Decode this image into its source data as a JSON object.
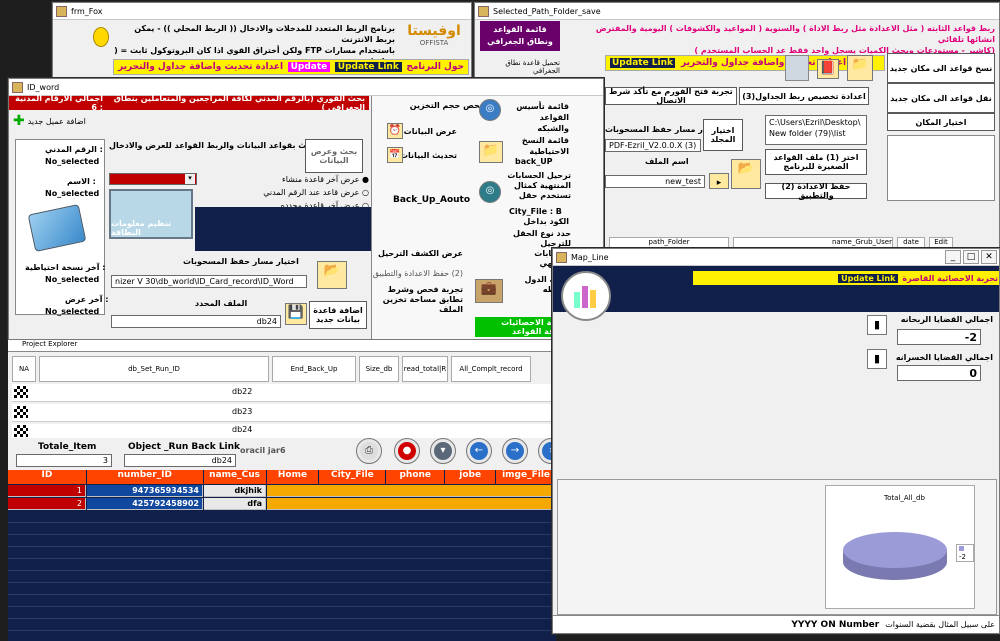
{
  "frm_fox": {
    "title": "frm_Fox",
    "logo_main": "اوفيستا",
    "logo_sub": "OFFISTA",
    "desc1": "برنامج الربط المتعدد للمدخلات والادخال (( الربط المحلي )) - يمكن بربط الانترنت",
    "desc2": "باستخدام مسارات  FTP  ولكن أختراق القوي اذا كان البروتوكول ثابت = ( خطر )",
    "update_link": "Update Link",
    "update_prog": "حول البرنامج",
    "update2": "Update",
    "update2_text": "اعدادة تحديث واضافة جداول والتحرير",
    "bar2_text": "Update Link"
  },
  "path_folder": {
    "title": "Selected_Path_Folder_save",
    "header_text1": "ربط قواعد الثابته ( مثل الاعدادة مثل ربط الاداة ) والسنوية ( المواعيد والكشوفات ) اليومية والمفترض انشائها تلقائي",
    "header_text2": "(كاشير - مستودعات وبحث الكميات يسجل واحد فقط عد الحساب المستخدم )",
    "menu_label": "قائمة القواعد ونطاق الجغرافي",
    "update_link": "Update Link",
    "update_text": "اعدادة تحديث واضافة جداول والتحرير",
    "copy_db": "نسخ قواعد الى مكان جديد",
    "move_db": "نقل قواعد الى مكان جديد",
    "select_place": "اختيار المكان",
    "btn_3": "(3)اعدادة تخصيص ربط الجداول",
    "btn_test": "تجربة فتح الفورم مع تأكد شرط الاتصال",
    "lbl_path": "اختيار مسار حفظ المسحوبات",
    "choose_folder": "اختيار المجلد",
    "path_value": "PDF-Ezril_V2.0.0.X (3)",
    "lbl_filename": "اسم الملف",
    "filename": "new_test",
    "folder_path": "C:\\Users\\Ezril\\Desktop\\ New folder (79)\\list",
    "btn_1": "اختر (1) ملف القواعد الصغيرة للبرنامج",
    "btn_2": "(2) حفظ الاعدادة والتطبيق",
    "col_path": "path_Folder",
    "col_name": "name_Grub_User",
    "col_date": "date",
    "col_edit": "Edit",
    "menu_sub": "تحميل قاعدة نطاق الجغرافي"
  },
  "id_word": {
    "title": "ID_word",
    "header_title": "اجمالي الارقام المدنية : 6",
    "header_sub": "بحث القوري (بالرقم المدني لكافة المراجعين والمتعاملين بنطاق الجغرافي )",
    "add_client": "اضافة عميل جديد",
    "lbl_civil": "الرقم المدني :",
    "civil_val": "No_selected",
    "lbl_name": "الاسم :",
    "name_val": "No_selected",
    "lbl_backup": "آخر نسخة احتياطية :",
    "backup_val": "No_selected",
    "lbl_view": "آخر عرض :",
    "view_val": "No_selected",
    "search_title": "بحث بقواعد البيانات والربط القواعد للعرض والادخال EZ",
    "search_btn": "بحث وعرض البيانات",
    "radio1": "عرض آخر قاعدة منشاء",
    "radio2": "عرض قاعد عند الرقم المدني",
    "radio3": "عرض آخر قاعدة محدده",
    "card_label": "تنظيم معلومات البطاقة",
    "lbl_save_path": "اختيار مسار حفظ المسحوبات",
    "save_path": "nizer V 30\\db_world\\ID_Card_record\\ID_Word",
    "lbl_file": "الملف المحدد",
    "file_val": "db24",
    "add_db": "اضافة قاعدة بيانات جديد",
    "menu": {
      "storage": "فحص حجم التخزين",
      "show_data": "عرض البيانات",
      "update_data": "تحديث البيانات",
      "backup": "Back_Up_Aouto",
      "view_transfer": "عرض الكشف الترحيل",
      "save_apply": "(2) حفظ الاعدادة والتطبيق",
      "test_check": "تجربة فحص وشرط تطابق مساحة تخزين الملف",
      "network": "قائمة تأسيس القواعد والشبكه",
      "backup_list": "قائمة النسخ الاحتياطية",
      "backup_up": "back_UP",
      "transfer": "ترحيل الحسابات المنتهية كمثال تستخدم حقل",
      "city_file": "City_File : B",
      "code_label": "الكود بداخل",
      "transfer_type": "حدد نوع الحقل للترحيل الحسابات للمنتهي",
      "map_label": "قائمة الدول المغطه",
      "stats": "قائمة الاحصائيات بطاقة القواعد"
    }
  },
  "explorer": {
    "title": "Project Explorer",
    "cols": [
      "NA",
      "db_Set_Run_ID",
      "End_Back_Up",
      "Size_db",
      "read_total|R",
      "All_Complt_record"
    ],
    "rows": [
      "db22",
      "db23",
      "db24"
    ],
    "totale_label": "Totale_Item",
    "totale_val": "3",
    "object_label": "Object _Run Back Link",
    "object_val": "db24",
    "oracle": "oracil jar6"
  },
  "table": {
    "headers": [
      "ID",
      "number_ID",
      "name_Cus",
      "Home",
      "City_File",
      "phone",
      "jobe",
      "imge_File"
    ],
    "rows": [
      {
        "id": "1",
        "number": "947365934534",
        "name": "dkjhik"
      },
      {
        "id": "2",
        "number": "425792458902",
        "name": "dfa"
      }
    ]
  },
  "map_line": {
    "title": "Map_Line",
    "update_link": "Update Link",
    "header_text": "تجربة الاحصائية القاصرة",
    "lbl_win": "اجمالي القضايا الربحانه",
    "val_win": "-2",
    "lbl_lose": "اجمالي القضايا الخسرانه",
    "val_lose": "0",
    "chart_title": "Total_All_db",
    "legend": "-2",
    "footer_text": "على سبيل المثال بقضية السنوات",
    "footer_num": "YYYY ON Number"
  }
}
